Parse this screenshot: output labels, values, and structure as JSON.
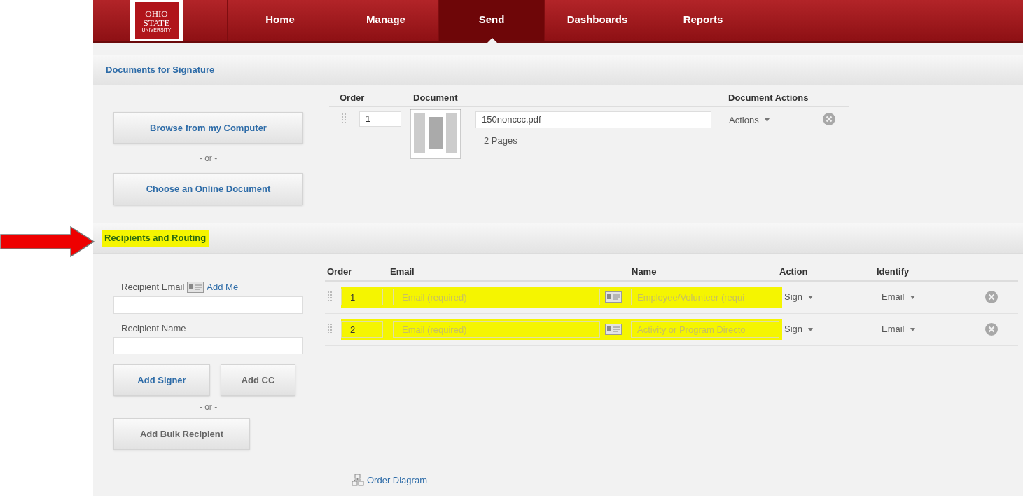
{
  "logo": {
    "lines": [
      "OHIO",
      "STATE",
      "UNIVERSITY"
    ]
  },
  "nav": [
    {
      "label": "Home",
      "selected": false
    },
    {
      "label": "Manage",
      "selected": false
    },
    {
      "label": "Send",
      "selected": true
    },
    {
      "label": "Dashboards",
      "selected": false
    },
    {
      "label": "Reports",
      "selected": false
    }
  ],
  "documents": {
    "title": "Documents for Signature",
    "highlighted": false,
    "browse_button": "Browse from my Computer",
    "or": "- or -",
    "online_button": "Choose an Online Document",
    "columns": [
      "Order",
      "Document",
      "Document Actions"
    ],
    "rows": [
      {
        "order": "1",
        "file": "150nonccc.pdf",
        "pages": "2 Pages",
        "actions": "Actions"
      }
    ]
  },
  "recipients": {
    "title": "Recipients and Routing",
    "highlighted": true,
    "email_label": "Recipient Email",
    "add_me": "Add Me",
    "name_label": "Recipient Name",
    "add_signer": "Add Signer",
    "add_cc": "Add CC",
    "or": "- or -",
    "bulk_button": "Add Bulk Recipient",
    "columns": [
      "Order",
      "Email",
      "Name",
      "Action",
      "Identify"
    ],
    "rows": [
      {
        "order": "1",
        "email_placeholder": "Email (required)",
        "name_placeholder": "Employee/Volunteer (requi",
        "action": "Sign",
        "identify": "Email",
        "highlighted": true
      },
      {
        "order": "2",
        "email_placeholder": "Email (required)",
        "name_placeholder": "Activity or Program Directo",
        "action": "Sign",
        "identify": "Email",
        "highlighted": true
      }
    ],
    "order_diagram": "Order Diagram"
  }
}
